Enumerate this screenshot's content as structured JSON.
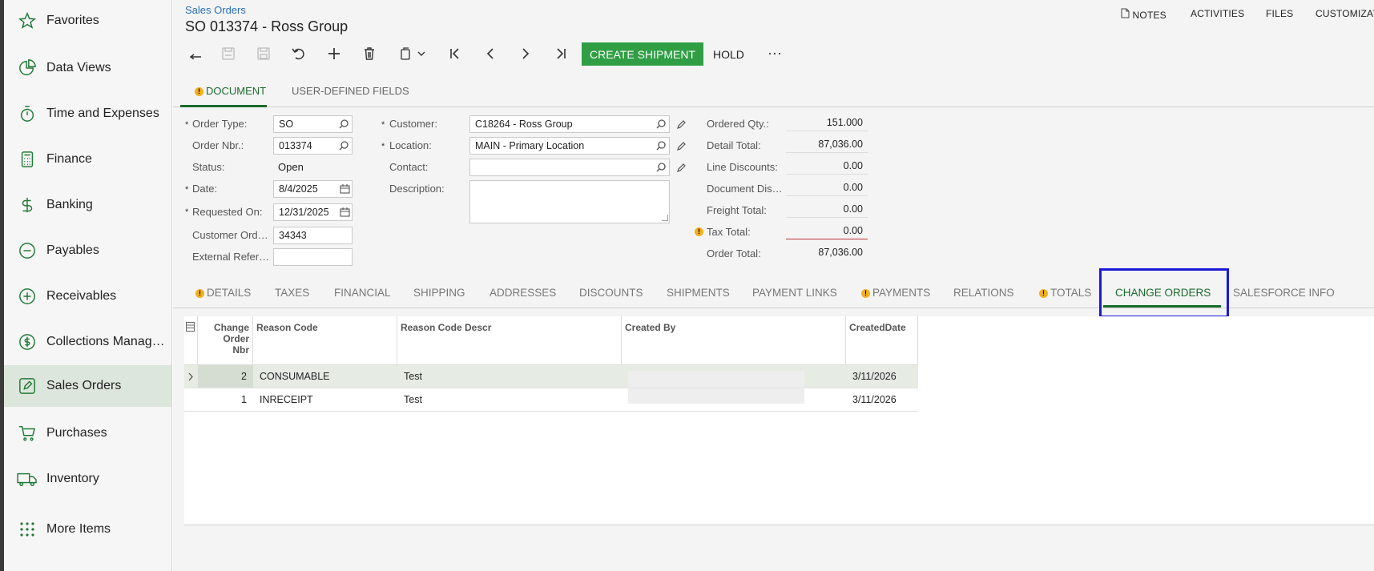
{
  "sidebar": {
    "items": [
      {
        "label": "Favorites",
        "icon": "star-icon"
      },
      {
        "label": "Data Views",
        "icon": "pie-chart-icon"
      },
      {
        "label": "Time and Expenses",
        "icon": "stopwatch-icon"
      },
      {
        "label": "Finance",
        "icon": "calculator-icon"
      },
      {
        "label": "Banking",
        "icon": "dollar-icon"
      },
      {
        "label": "Payables",
        "icon": "minus-circle-icon"
      },
      {
        "label": "Receivables",
        "icon": "plus-circle-icon"
      },
      {
        "label": "Collections Manag…",
        "icon": "dollar-circle-icon"
      },
      {
        "label": "Sales Orders",
        "icon": "edit-icon"
      },
      {
        "label": "Purchases",
        "icon": "cart-icon"
      },
      {
        "label": "Inventory",
        "icon": "truck-icon"
      },
      {
        "label": "More Items",
        "icon": "grid-dots-icon"
      }
    ]
  },
  "header": {
    "breadcrumb": "Sales Orders",
    "title": "SO 013374 - Ross Group",
    "links": {
      "notes": "NOTES",
      "activities": "ACTIVITIES",
      "files": "FILES",
      "customization": "CUSTOMIZAT"
    }
  },
  "toolbar": {
    "create_shipment": "CREATE SHIPMENT",
    "hold": "HOLD",
    "more": "···"
  },
  "doc_tabs": {
    "document": "DOCUMENT",
    "user_defined": "USER-DEFINED FIELDS"
  },
  "form": {
    "order_type": {
      "label": "Order Type:",
      "value": "SO"
    },
    "order_nbr": {
      "label": "Order Nbr.:",
      "value": "013374"
    },
    "status": {
      "label": "Status:",
      "value": "Open"
    },
    "date": {
      "label": "Date:",
      "value": "8/4/2025"
    },
    "requested_on": {
      "label": "Requested On:",
      "value": "12/31/2025"
    },
    "customer_ord": {
      "label": "Customer Ord…",
      "value": "34343"
    },
    "external_ref": {
      "label": "External Refer…",
      "value": ""
    },
    "customer": {
      "label": "Customer:",
      "value": "C18264 - Ross Group"
    },
    "location": {
      "label": "Location:",
      "value": "MAIN - Primary Location"
    },
    "contact": {
      "label": "Contact:",
      "value": ""
    },
    "description": {
      "label": "Description:",
      "value": ""
    }
  },
  "totals": [
    {
      "label": "Ordered Qty.:",
      "value": "151.000"
    },
    {
      "label": "Detail Total:",
      "value": "87,036.00"
    },
    {
      "label": "Line Discounts:",
      "value": "0.00"
    },
    {
      "label": "Document Dis…",
      "value": "0.00"
    },
    {
      "label": "Freight Total:",
      "value": "0.00"
    },
    {
      "label": "Tax Total:",
      "value": "0.00"
    },
    {
      "label": "Order Total:",
      "value": "87,036.00"
    }
  ],
  "grid_tabs": [
    "DETAILS",
    "TAXES",
    "FINANCIAL",
    "SHIPPING",
    "ADDRESSES",
    "DISCOUNTS",
    "SHIPMENTS",
    "PAYMENT LINKS",
    "PAYMENTS",
    "RELATIONS",
    "TOTALS",
    "CHANGE ORDERS",
    "SALESFORCE INFO"
  ],
  "grid": {
    "columns": {
      "nbr_line1": "Change",
      "nbr_line2": "Order",
      "nbr_line3": "Nbr",
      "reason_code": "Reason Code",
      "reason_desc": "Reason Code Descr",
      "created_by": "Created By",
      "created_date": "CreatedDate"
    },
    "rows": [
      {
        "nbr": "2",
        "reason_code": "CONSUMABLE",
        "reason_desc": "Test",
        "created_by": "",
        "created_date": "3/11/2026"
      },
      {
        "nbr": "1",
        "reason_code": "INRECEIPT",
        "reason_desc": "Test",
        "created_by": "",
        "created_date": "3/11/2026"
      }
    ]
  },
  "colors": {
    "accent": "#2f9e44",
    "highlight": "#1a1ad6",
    "active_nav": "#dde6dc",
    "warning": "#f2b01e"
  }
}
